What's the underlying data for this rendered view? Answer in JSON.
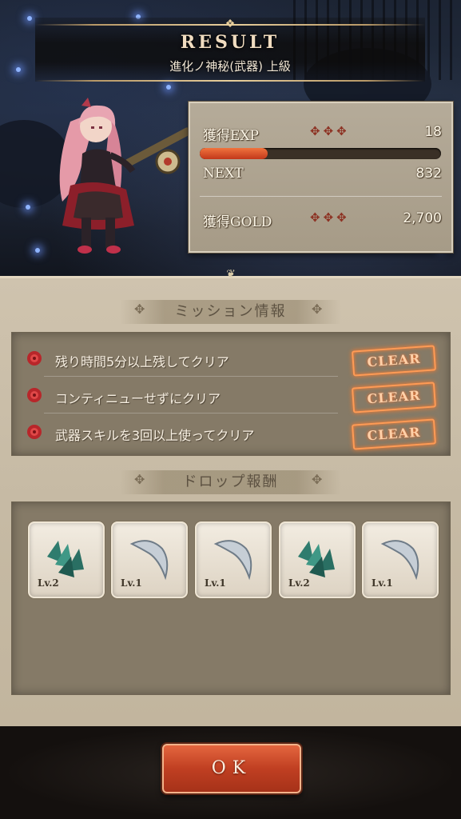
{
  "header": {
    "title": "RESULT",
    "subtitle": "進化ノ神秘(武器) 上級"
  },
  "stats": {
    "exp_label": "獲得EXP",
    "exp_stars": "✥✥✥",
    "exp_value": "18",
    "exp_progress_fraction": 0.28,
    "next_label": "NEXT",
    "next_value": "832",
    "gold_label": "獲得GOLD",
    "gold_stars": "✥✥✥",
    "gold_value": "2,700"
  },
  "missions": {
    "heading": "ミッション情報",
    "items": [
      {
        "text": "残り時間5分以上残してクリア",
        "status": "CLEAR"
      },
      {
        "text": "コンティニューせずにクリア",
        "status": "CLEAR"
      },
      {
        "text": "武器スキルを3回以上使ってクリア",
        "status": "CLEAR"
      }
    ]
  },
  "drops": {
    "heading": "ドロップ報酬",
    "items": [
      {
        "icon": "green-scale-icon",
        "level": "Lv.2"
      },
      {
        "icon": "silver-claw-icon",
        "level": "Lv.1"
      },
      {
        "icon": "silver-claw-icon",
        "level": "Lv.1"
      },
      {
        "icon": "green-scale-icon",
        "level": "Lv.2"
      },
      {
        "icon": "silver-claw-icon",
        "level": "Lv.1"
      }
    ]
  },
  "ok_button": {
    "label": "OK"
  },
  "colors": {
    "exp_fill": "#e0562c",
    "clear_stamp": "#ff9b55",
    "ok_button": "#c03f22",
    "rose": "#b8262a"
  }
}
